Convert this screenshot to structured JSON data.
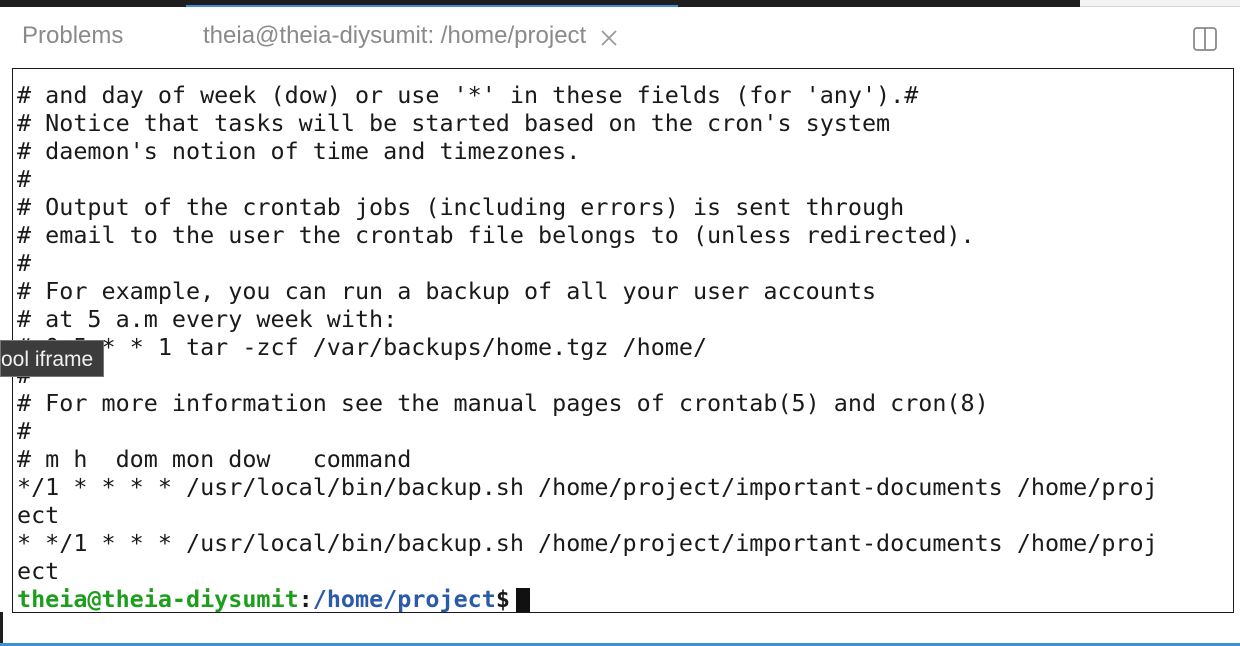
{
  "tabs": {
    "problems_label": "Problems",
    "terminal_label": "theia@theia-diysumit: /home/project",
    "close_icon": "close-icon",
    "split_icon": "split-editor-icon"
  },
  "colors": {
    "tab_active_accent": "#3f8fd2",
    "prompt_user": "#1f9d1f",
    "prompt_path": "#2b5aa8",
    "tooltip_bg": "#3c3c3c"
  },
  "terminal": {
    "lines": [
      "# and day of week (dow) or use '*' in these fields (for 'any').#",
      "# Notice that tasks will be started based on the cron's system",
      "# daemon's notion of time and timezones.",
      "#",
      "# Output of the crontab jobs (including errors) is sent through",
      "# email to the user the crontab file belongs to (unless redirected).",
      "#",
      "# For example, you can run a backup of all your user accounts",
      "# at 5 a.m every week with:",
      "# 0 5 * * 1 tar -zcf /var/backups/home.tgz /home/",
      "#",
      "# For more information see the manual pages of crontab(5) and cron(8)",
      "#",
      "# m h  dom mon dow   command",
      "*/1 * * * * /usr/local/bin/backup.sh /home/project/important-documents /home/proj",
      "ect",
      "* */1 * * * /usr/local/bin/backup.sh /home/project/important-documents /home/proj",
      "ect"
    ],
    "prompt": {
      "user_host": "theia@theia-diysumit",
      "separator": ":",
      "path": "/home/project",
      "symbol": "$"
    }
  },
  "tooltip": {
    "text": "ool iframe"
  }
}
